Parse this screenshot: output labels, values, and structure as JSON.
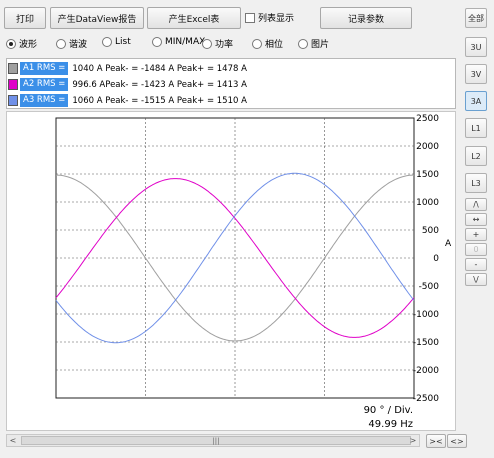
{
  "toolbar": {
    "print": "打印",
    "dataview_report": "产生DataView报告",
    "excel_report": "产生Excel表",
    "list_display": "列表显示",
    "record_params": "记录参数"
  },
  "modes": {
    "waveform": "波形",
    "harmonics": "谐波",
    "list": "List",
    "minmax": "MIN/MAX",
    "power": "功率",
    "phase": "相位",
    "image": "图片",
    "selected": "waveform"
  },
  "legend": [
    {
      "tag": "A1 RMS =",
      "value": "1040 A Peak- = -1484 A   Peak+ = 1478 A",
      "color": "#a0a0a0"
    },
    {
      "tag": "A2 RMS =",
      "value": "996.6 APeak- = -1423 A   Peak+ = 1413 A",
      "color": "#e000c8"
    },
    {
      "tag": "A3 RMS =",
      "value": "1060 A Peak- = -1515 A   Peak+ = 1510 A",
      "color": "#7090e8"
    }
  ],
  "sidebar": {
    "all": "全部",
    "3U": "3U",
    "3V": "3V",
    "3A": "3A",
    "L1": "L1",
    "L2": "L2",
    "L3": "L3",
    "up": "/\\",
    "expand": "↔",
    "plus": "+",
    "zero": "0",
    "minus": "-",
    "down": "\\/",
    "selected": "3A"
  },
  "axis": {
    "unit": "A",
    "yticks": [
      "2500",
      "2000",
      "1500",
      "1000",
      "500",
      "0",
      "-500",
      "-1000",
      "-1500",
      "-2000",
      "-2500"
    ]
  },
  "status": {
    "division": "90 °  / Div.",
    "frequency": "49.99 Hz"
  },
  "scroll": {
    "left": "<",
    "right": ">",
    "grip": "|||",
    "btn_fit": "><",
    "btn_expand": "<>"
  },
  "chart_data": {
    "type": "line",
    "x_unit": "degrees",
    "ylim": [
      -2500,
      2500
    ],
    "ylabel": "A",
    "grid": true,
    "series": [
      {
        "name": "A1",
        "color": "#a0a0a0",
        "peak_neg": -1484,
        "peak_pos": 1478,
        "phase_deg": 120
      },
      {
        "name": "A2",
        "color": "#e000c8",
        "peak_neg": -1423,
        "peak_pos": 1413,
        "phase_deg": 0
      },
      {
        "name": "A3",
        "color": "#7090e8",
        "peak_neg": -1515,
        "peak_pos": 1510,
        "phase_deg": -120
      }
    ]
  }
}
